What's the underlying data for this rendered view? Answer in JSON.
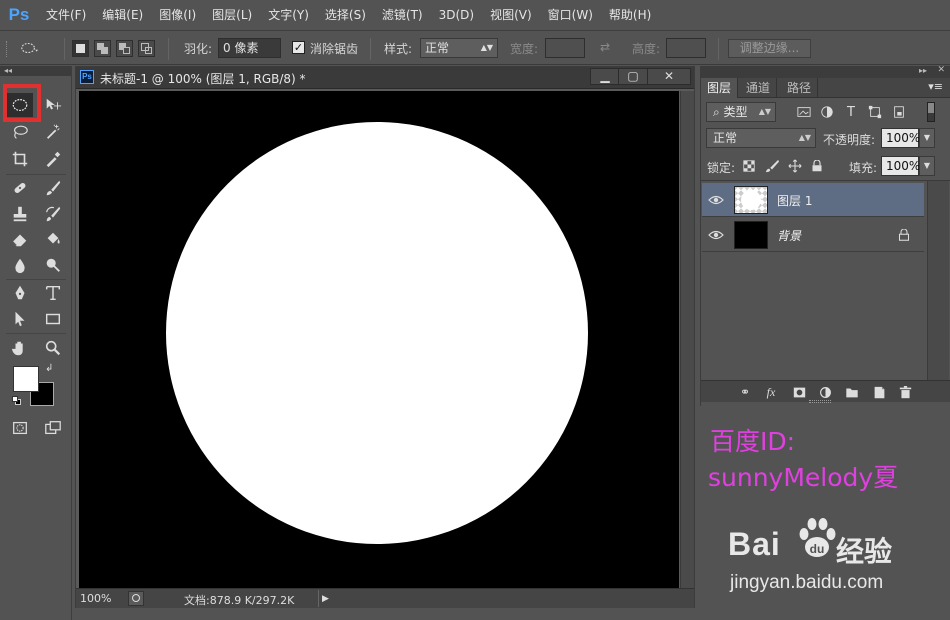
{
  "app": {
    "logo": "Ps"
  },
  "menu": [
    "文件(F)",
    "编辑(E)",
    "图像(I)",
    "图层(L)",
    "文字(Y)",
    "选择(S)",
    "滤镜(T)",
    "3D(D)",
    "视图(V)",
    "窗口(W)",
    "帮助(H)"
  ],
  "options": {
    "feather_label": "羽化:",
    "feather_value": "0 像素",
    "antialias_label": "消除锯齿",
    "antialias_checked": true,
    "style_label": "样式:",
    "style_value": "正常",
    "width_label": "宽度:",
    "height_label": "高度:",
    "refine_button": "调整边缘..."
  },
  "document": {
    "title": "未标题-1 @ 100% (图层 1, RGB/8) *",
    "zoom": "100%",
    "doc_info": "文档:878.9 K/297.2K",
    "canvas_color": "#000000",
    "shape_color": "#ffffff"
  },
  "layers_panel": {
    "tabs": [
      "图层",
      "通道",
      "路径"
    ],
    "filter_value": "类型",
    "blend_mode": "正常",
    "opacity_label": "不透明度:",
    "opacity_value": "100%",
    "lock_label": "锁定:",
    "fill_label": "填充:",
    "fill_value": "100%",
    "layers": [
      {
        "name": "图层 1",
        "selected": true,
        "locked": false
      },
      {
        "name": "背景",
        "selected": false,
        "locked": true
      }
    ]
  },
  "annotation": {
    "id_line": "百度ID:",
    "name_line": "sunnyMelody夏",
    "color": "#e040e0"
  },
  "watermark": {
    "brand": "Bai  du",
    "cn": "经验",
    "url": "jingyan.baidu.com"
  },
  "colors": {
    "foreground": "#ffffff",
    "background": "#000000",
    "selection_highlight": "#e03030"
  }
}
